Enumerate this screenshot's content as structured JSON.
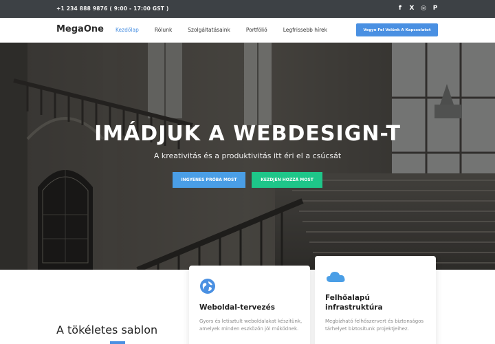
{
  "topbar": {
    "phone": "+1 234 888 9876 ( 9:00 - 17:00 GST )",
    "social": [
      "f",
      "X",
      "◎",
      "P"
    ],
    "social_names": [
      "facebook-icon",
      "x-icon",
      "instagram-icon",
      "pinterest-icon"
    ]
  },
  "nav": {
    "logo": "MegaOne",
    "items": [
      "Kezdőlap",
      "Rólunk",
      "Szolgáltatásaink",
      "Portfólió",
      "Legfrissebb hírek"
    ],
    "cta": "Vegye Fel Velünk A Kapcsolatot"
  },
  "hero": {
    "title": "IMÁDJUK A WEBDESIGN-T",
    "subtitle": "A kreativitás és a produktivitás itt éri el a csúcsát",
    "btn_trial": "INGYENES PRÓBA MOST",
    "btn_join": "KEZDJEN HOZZÁ MOST"
  },
  "section": {
    "heading": "A tökéletes sablon"
  },
  "cards": [
    {
      "icon": "globe-icon",
      "title": "Weboldal-tervezés",
      "text": "Gyors és letisztult weboldalakat készítünk, amelyek minden eszközön jól működnek."
    },
    {
      "icon": "cloud-icon",
      "title": "Felhőalapú infrastruktúra",
      "text": "Megbízható felhőszervert és biztonságos tárhelyet biztosítunk projektjeihez."
    }
  ],
  "colors": {
    "accent": "#4a90e2",
    "green": "#1ec689",
    "topbar": "#3d4145"
  }
}
